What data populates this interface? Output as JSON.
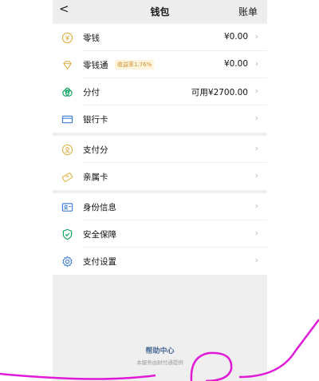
{
  "nav": {
    "back": "<",
    "title": "钱包",
    "bill": "账单"
  },
  "group1": [
    {
      "label": "零钱",
      "value": "¥0.00",
      "icon": "coin-icon"
    },
    {
      "label": "零钱通",
      "tag": "收益率1.76%",
      "value": "¥0.00",
      "icon": "diamond-icon"
    },
    {
      "label": "分付",
      "value": "可用¥2700.00",
      "icon": "installment-icon"
    },
    {
      "label": "银行卡",
      "value": "",
      "icon": "bank-card-icon"
    }
  ],
  "group2": [
    {
      "label": "支付分",
      "icon": "score-icon"
    },
    {
      "label": "亲属卡",
      "icon": "family-card-icon"
    }
  ],
  "group3": [
    {
      "label": "身份信息",
      "icon": "id-card-icon"
    },
    {
      "label": "安全保障",
      "icon": "shield-icon"
    },
    {
      "label": "支付设置",
      "icon": "gear-icon"
    }
  ],
  "footer": {
    "help": "帮助中心",
    "provider": "本服务由财付通提供"
  },
  "colors": {
    "accent": "#07a25c",
    "gold": "#e0b44a",
    "link": "#4a6a94",
    "swirl": "#e01ad6"
  }
}
